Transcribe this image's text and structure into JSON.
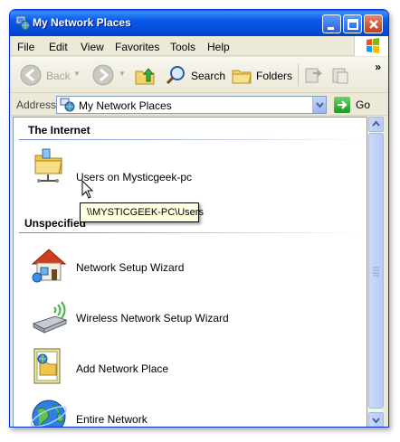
{
  "window": {
    "title": "My Network Places",
    "icon": "network-places-icon"
  },
  "menu": [
    "File",
    "Edit",
    "View",
    "Favorites",
    "Tools",
    "Help"
  ],
  "toolbar": {
    "back_label": "Back",
    "search_label": "Search",
    "folders_label": "Folders",
    "overflow_glyph": "»"
  },
  "address": {
    "label": "Address",
    "value": "My Network Places",
    "go_label": "Go"
  },
  "groups": [
    {
      "header": "The Internet",
      "items": [
        {
          "label": "Users on Mysticgeek-pc",
          "icon": "shared-folder-icon"
        }
      ]
    },
    {
      "header": "Unspecified",
      "items": [
        {
          "label": "Network Setup Wizard",
          "icon": "network-setup-wizard-icon"
        },
        {
          "label": "Wireless Network Setup Wizard",
          "icon": "wireless-wizard-icon"
        },
        {
          "label": "Add Network Place",
          "icon": "add-network-place-icon"
        },
        {
          "label": "Entire Network",
          "icon": "entire-network-icon"
        }
      ]
    }
  ],
  "tooltip": "\\\\MYSTICGEEK-PC\\Users",
  "colors": {
    "titlebar": "#0a5ae8",
    "group_rule": "#6b89c6",
    "tooltip_bg": "#ffffe1"
  }
}
